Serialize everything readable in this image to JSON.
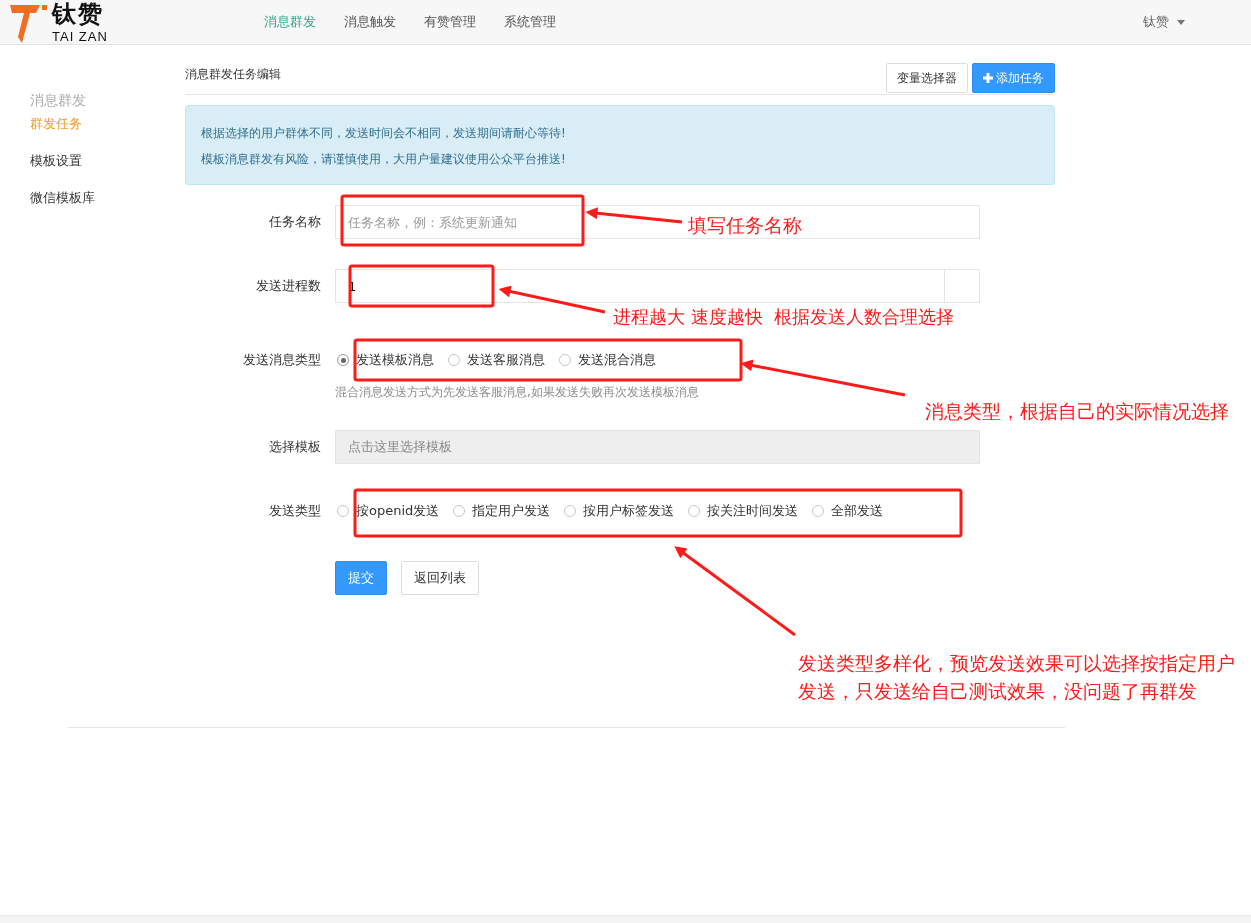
{
  "header": {
    "logo": {
      "name": "钛赞",
      "subtitle": "TAI ZAN"
    },
    "nav": [
      {
        "label": "消息群发",
        "selected": true
      },
      {
        "label": "消息触发",
        "selected": false
      },
      {
        "label": "有赞管理",
        "selected": false
      },
      {
        "label": "系统管理",
        "selected": false
      }
    ],
    "user": "钛赞"
  },
  "sidebar": {
    "heading": "消息群发",
    "items": [
      {
        "label": "群发任务",
        "selected": true
      },
      {
        "label": "模板设置",
        "selected": false
      },
      {
        "label": "微信模板库",
        "selected": false
      }
    ]
  },
  "page": {
    "title": "消息群发任务编辑",
    "buttons": [
      {
        "label": "变量选择器",
        "kind": "default"
      },
      {
        "label": "添加任务",
        "kind": "primary"
      }
    ],
    "alert": [
      "根据选择的用户群体不同，发送时间会不相同，发送期间请耐心等待!",
      "模板消息群发有风险，请谨慎使用，大用户量建议使用公众平台推送!"
    ],
    "form": [
      {
        "kind": "text",
        "label": "任务名称",
        "placeholder": "任务名称，例：系统更新通知"
      },
      {
        "kind": "number",
        "label": "发送进程数",
        "value": "1"
      },
      {
        "kind": "radio",
        "label": "发送消息类型",
        "options": [
          {
            "label": "发送模板消息",
            "selected": true
          },
          {
            "label": "发送客服消息",
            "selected": false
          },
          {
            "label": "发送混合消息",
            "selected": false
          }
        ],
        "help": "混合消息发送方式为先发送客服消息,如果发送失败再次发送模板消息"
      },
      {
        "kind": "picker",
        "label": "选择模板",
        "placeholder": "点击这里选择模板"
      },
      {
        "kind": "radio",
        "label": "发送类型",
        "options": [
          {
            "label": "按openid发送",
            "selected": false
          },
          {
            "label": "指定用户发送",
            "selected": false
          },
          {
            "label": "按用户标签发送",
            "selected": false
          },
          {
            "label": "按关注时间发送",
            "selected": false
          },
          {
            "label": "全部发送",
            "selected": false
          }
        ]
      }
    ],
    "actions": [
      {
        "label": "提交",
        "kind": "primary"
      },
      {
        "label": "返回列表",
        "kind": "default"
      }
    ]
  },
  "annotations": [
    {
      "note": "填写任务名称"
    },
    {
      "note": "进程越大 速度越快  根据发送人数合理选择"
    },
    {
      "note": "消息类型，根据自己的实际情况选择"
    },
    {
      "note": "发送类型多样化，预览发送效果可以选择按指定用户发送，只发送给自己测试效果，没问题了再群发"
    }
  ]
}
